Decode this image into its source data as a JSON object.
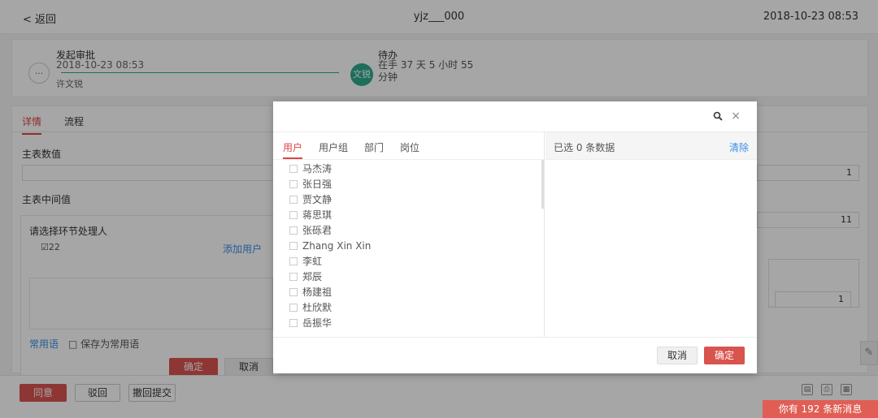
{
  "topbar": {
    "back": "< 返回",
    "title": "yjz___000",
    "time": "2018-10-23 08:53"
  },
  "progress": {
    "dots": "...",
    "step1_title": "发起审批",
    "step1_date": "2018-10-23 08:53",
    "step1_user": "许文锐",
    "avatar": "文锐",
    "step2_title": "待办",
    "step2_detail": "在手 37 天 5 小时 55 分钟"
  },
  "tabs": {
    "detail": "详情",
    "flow": "流程"
  },
  "form": {
    "main_value": "主表数值",
    "main_middle": "主表中间值",
    "field1": "1",
    "field2": "11",
    "field3": "1"
  },
  "selector": {
    "heading": "请选择环节处理人",
    "checked_item": "☑22",
    "add_user": "添加用户",
    "common_phrase": "常用语",
    "save_common": "□ 保存为常用语",
    "ok": "确定",
    "cancel": "取消"
  },
  "bottom": {
    "agree": "同意",
    "reject": "驳回",
    "withdraw": "撤回提交",
    "messages": "你有 192 条新消息"
  },
  "modal": {
    "tabs": [
      "用户",
      "用户组",
      "部门",
      "岗位"
    ],
    "users": [
      "马杰涛",
      "张日强",
      "贾文静",
      "蒋思琪",
      "张砾君",
      "Zhang Xin Xin",
      "李虹",
      "郑辰",
      "杨建祖",
      "杜欣默",
      "岳振华"
    ],
    "selected_count": "已选 0 条数据",
    "clear": "清除",
    "cancel": "取消",
    "ok": "确定"
  }
}
